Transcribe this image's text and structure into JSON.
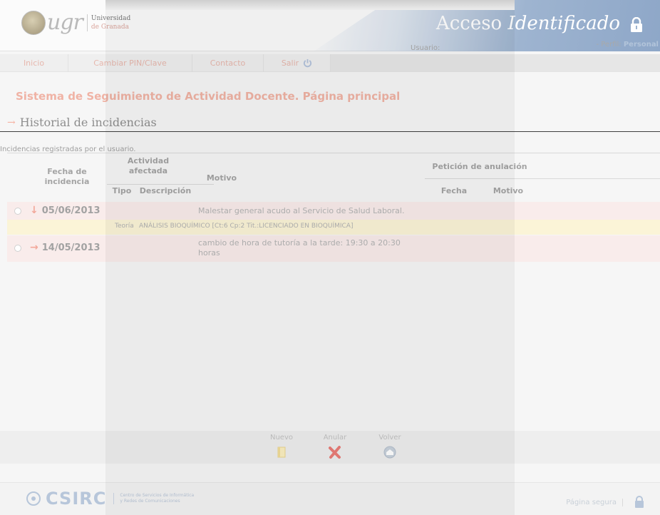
{
  "header": {
    "logo_text": "ugr",
    "university_line1": "Universidad",
    "university_line2": "de Granada",
    "title_word1": "Acceso",
    "title_word2": "Identificado",
    "usuario_label": "Usuario:",
    "perfil_label": "- Perfil:",
    "perfil_value": "Personal"
  },
  "nav": {
    "items": [
      {
        "label": "Inicio"
      },
      {
        "label": "Cambiar PIN/Clave"
      },
      {
        "label": "Contacto"
      },
      {
        "label": "Salir"
      }
    ]
  },
  "page": {
    "title": "Sistema de Seguimiento de Actividad Docente. Página principal",
    "section_title": "Historial de incidencias",
    "intro": "Incidencias registradas por el usuario."
  },
  "table": {
    "headers": {
      "fecha": "Fecha de incidencia",
      "actividad": "Actividad afectada",
      "tipo": "Tipo",
      "descripcion": "Descripción",
      "motivo": "Motivo",
      "peticion": "Petición de anulación",
      "pet_fecha": "Fecha",
      "pet_motivo": "Motivo"
    },
    "rows": [
      {
        "date": "05/06/2013",
        "direction": "down",
        "motivo": "Malestar general acudo al Servicio de Salud Laboral."
      },
      {
        "date": "14/05/2013",
        "direction": "right",
        "motivo": "cambio de hora de tutoría a la tarde: 19:30 a 20:30 horas"
      }
    ],
    "detail": {
      "tipo": "Teoría",
      "descripcion": "ANÁLISIS BIOQUÍMICO [Ct:6 Cp:2 Tit.:LICENCIADO EN BIOQUÍMICA]"
    }
  },
  "actions": {
    "nuevo": "Nuevo",
    "anular": "Anular",
    "volver": "Volver"
  },
  "footer": {
    "logo": "CSIRC",
    "desc_line1": "Centro de Servicios de Informática",
    "desc_line2": "y Redes de Comunicaciones",
    "segura": "Página segura"
  }
}
